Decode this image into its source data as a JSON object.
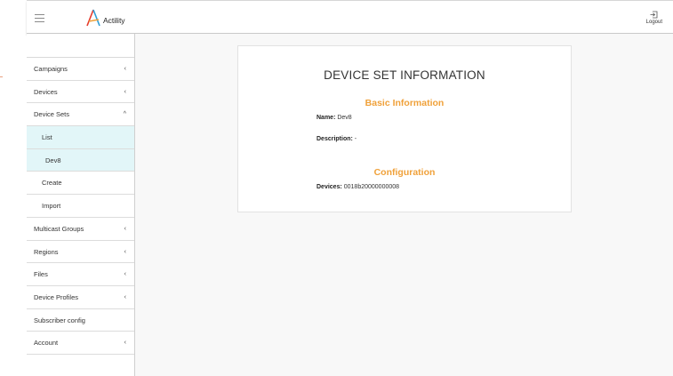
{
  "header": {
    "brand": "Actility",
    "logout_label": "Logout"
  },
  "sidebar": {
    "items": [
      {
        "label": "Campaigns",
        "chevron": "‹"
      },
      {
        "label": "Devices",
        "chevron": "‹"
      },
      {
        "label": "Device Sets",
        "chevron": "^"
      },
      {
        "label": "List"
      },
      {
        "label": "Dev8"
      },
      {
        "label": "Create"
      },
      {
        "label": "Import"
      },
      {
        "label": "Multicast Groups",
        "chevron": "‹"
      },
      {
        "label": "Regions",
        "chevron": "‹"
      },
      {
        "label": "Files",
        "chevron": "‹"
      },
      {
        "label": "Device Profiles",
        "chevron": "‹"
      },
      {
        "label": "Subscriber config"
      },
      {
        "label": "Account",
        "chevron": "‹"
      }
    ]
  },
  "main": {
    "title": "DEVICE SET INFORMATION",
    "basic_heading": "Basic Information",
    "name_label": "Name:",
    "name_value": "Dev8",
    "description_label": "Description:",
    "description_value": "-",
    "config_heading": "Configuration",
    "devices_label": "Devices:",
    "devices_value": "0018b20000000008"
  },
  "colors": {
    "accent_orange": "#f0a13a",
    "active_row": "#e2f6f8"
  },
  "icons": [
    "hamburger-icon",
    "actility-logo-icon",
    "logout-icon",
    "chevron-left-icon",
    "chevron-up-icon"
  ]
}
